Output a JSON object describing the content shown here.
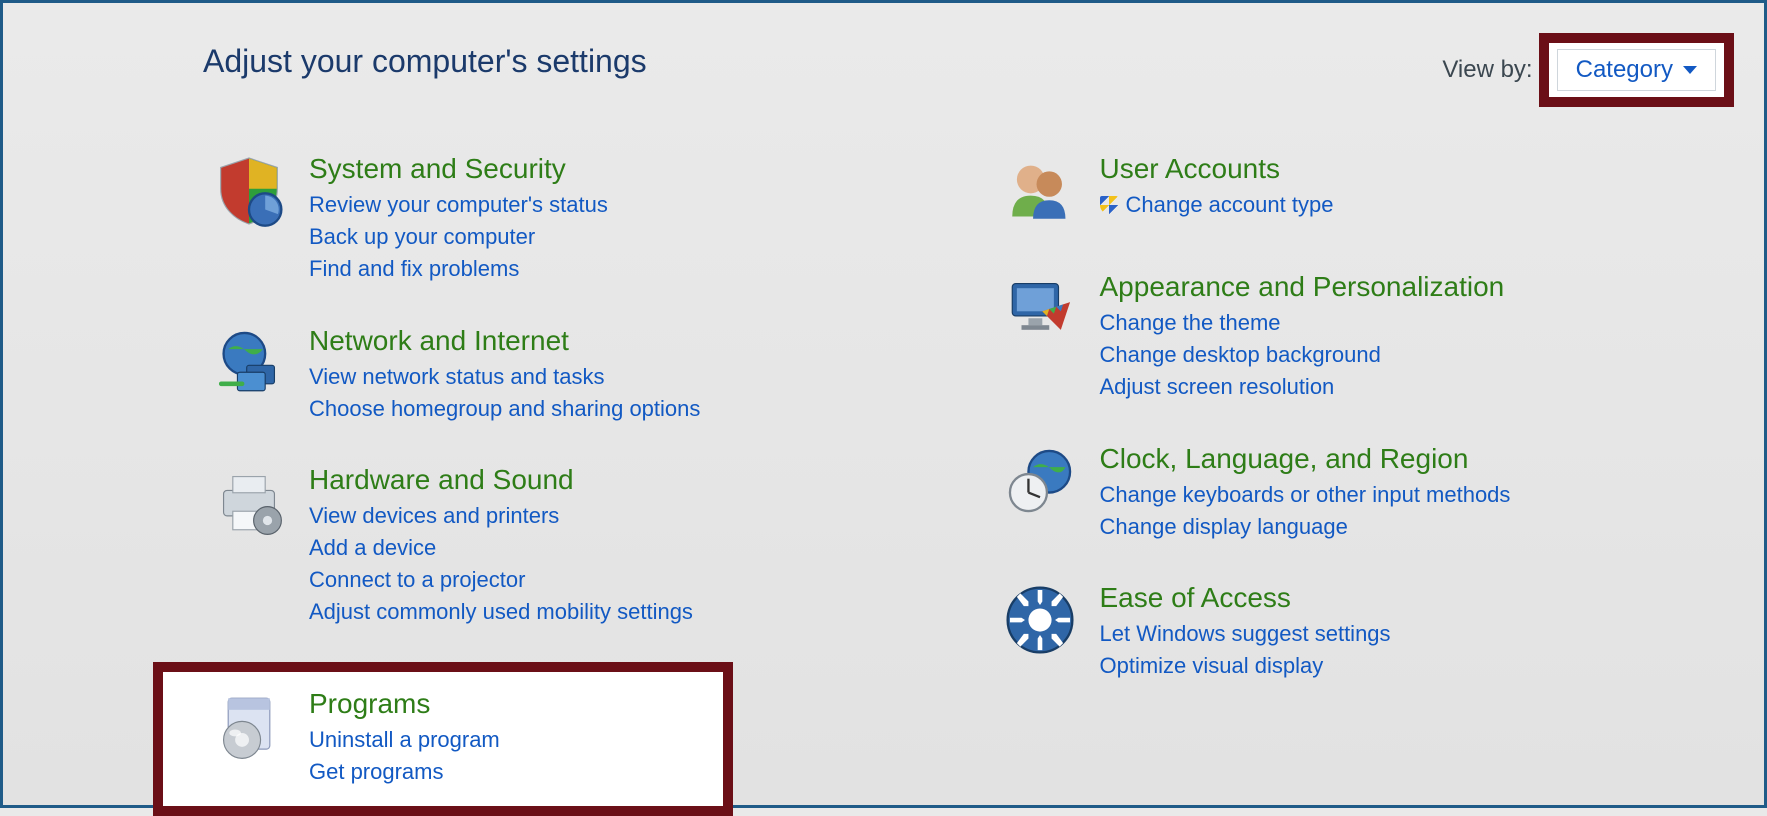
{
  "header": {
    "title": "Adjust your computer's settings",
    "viewby_label": "View by:",
    "viewby_value": "Category"
  },
  "left": [
    {
      "icon": "shield-chart",
      "title": "System and Security",
      "links": [
        "Review your computer's status",
        "Back up your computer",
        "Find and fix problems"
      ]
    },
    {
      "icon": "globe-net",
      "title": "Network and Internet",
      "links": [
        "View network status and tasks",
        "Choose homegroup and sharing options"
      ]
    },
    {
      "icon": "printer",
      "title": "Hardware and Sound",
      "links": [
        "View devices and printers",
        "Add a device",
        "Connect to a projector",
        "Adjust commonly used mobility settings"
      ]
    },
    {
      "icon": "box-disc",
      "title": "Programs",
      "highlighted": true,
      "links": [
        "Uninstall a program",
        "Get programs"
      ]
    }
  ],
  "right": [
    {
      "icon": "users",
      "title": "User Accounts",
      "links": [
        {
          "text": "Change account type",
          "shield": true
        }
      ]
    },
    {
      "icon": "monitor-color",
      "title": "Appearance and Personalization",
      "links": [
        "Change the theme",
        "Change desktop background",
        "Adjust screen resolution"
      ]
    },
    {
      "icon": "clock-globe",
      "title": "Clock, Language, and Region",
      "links": [
        "Change keyboards or other input methods",
        "Change display language"
      ]
    },
    {
      "icon": "ease-access",
      "title": "Ease of Access",
      "links": [
        "Let Windows suggest settings",
        "Optimize visual display"
      ]
    }
  ]
}
